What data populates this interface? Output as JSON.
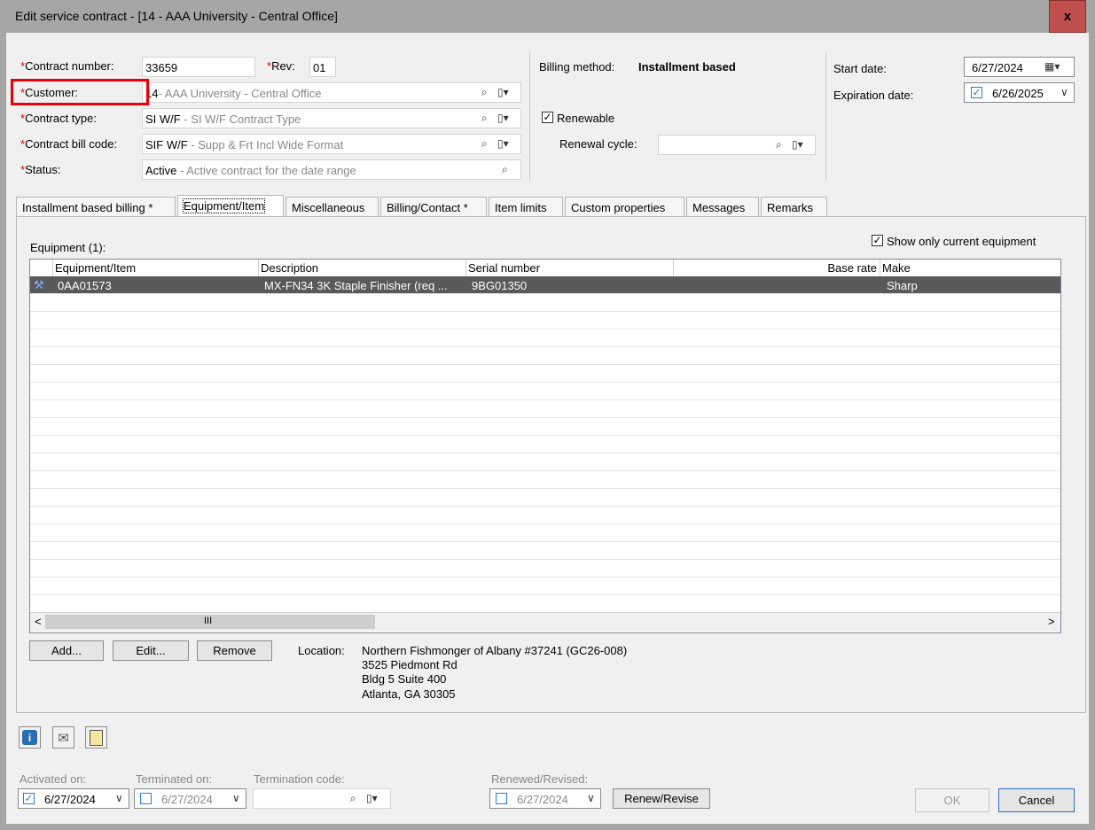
{
  "window": {
    "title": "Edit service contract - [14 - AAA University - Central Office]",
    "close": "x"
  },
  "form": {
    "contract_number_label": "Contract number:",
    "contract_number": "33659",
    "rev_label": "Rev:",
    "rev": "01",
    "customer_label": "Customer:",
    "customer_code": "14",
    "customer_desc": "- AAA University - Central Office",
    "contract_type_label": "Contract type:",
    "contract_type_code": "SI W/F",
    "contract_type_desc": " - SI W/F  Contract Type",
    "bill_code_label": "Contract bill code:",
    "bill_code_code": "SIF W/F",
    "bill_code_desc": " - Supp & Frt Incl Wide Format",
    "status_label": "Status:",
    "status_code": "Active",
    "status_desc": " - Active contract for the date range",
    "billing_method_label": "Billing method:",
    "billing_method": "Installment based",
    "renewable_label": "Renewable",
    "renewal_cycle_label": "Renewal cycle:",
    "start_date_label": "Start date:",
    "start_date": "6/27/2024",
    "expiration_date_label": "Expiration date:",
    "expiration_date": "6/26/2025",
    "asterisk": "*"
  },
  "tabs": [
    {
      "label": "Installment based billing *"
    },
    {
      "label": "Equipment/Item"
    },
    {
      "label": "Miscellaneous"
    },
    {
      "label": "Billing/Contact *"
    },
    {
      "label": "Item limits"
    },
    {
      "label": "Custom properties"
    },
    {
      "label": "Messages"
    },
    {
      "label": "Remarks"
    }
  ],
  "equipment": {
    "heading": "Equipment (1):",
    "show_current_label": "Show only current equipment",
    "columns": [
      "Equipment/Item",
      "Description",
      "Serial number",
      "Base rate",
      "Make"
    ],
    "rows": [
      {
        "item": "0AA01573",
        "description": "MX-FN34 3K Staple Finisher (req ...",
        "serial": "9BG01350",
        "base_rate": "",
        "make": "Sharp"
      }
    ],
    "scroll_left": "<",
    "scroll_right": ">",
    "scroll_grip": "III",
    "add_label": "Add...",
    "edit_label": "Edit...",
    "remove_label": "Remove",
    "location_label": "Location:",
    "location_lines": [
      "Northern Fishmonger of Albany #37241 (GC26-008)",
      "3525 Piedmont Rd",
      "Bldg 5 Suite 400",
      "Atlanta, GA 30305"
    ]
  },
  "footer": {
    "activated_label": "Activated on:",
    "activated_date": "6/27/2024",
    "terminated_label": "Terminated on:",
    "terminated_date": "6/27/2024",
    "termination_code_label": "Termination code:",
    "renewed_label": "Renewed/Revised:",
    "renewed_date": "6/27/2024",
    "renew_revise_label": "Renew/Revise",
    "ok_label": "OK",
    "cancel_label": "Cancel"
  },
  "colors": {
    "highlight_box": "#e8000b",
    "selected_row": "#595959",
    "title_close": "#c0504d"
  },
  "icons": [
    "close-icon",
    "lookup-icon",
    "dropdown-icon",
    "calendar-icon",
    "info-icon",
    "attach-icon",
    "copy-icon",
    "equipment-icon"
  ]
}
